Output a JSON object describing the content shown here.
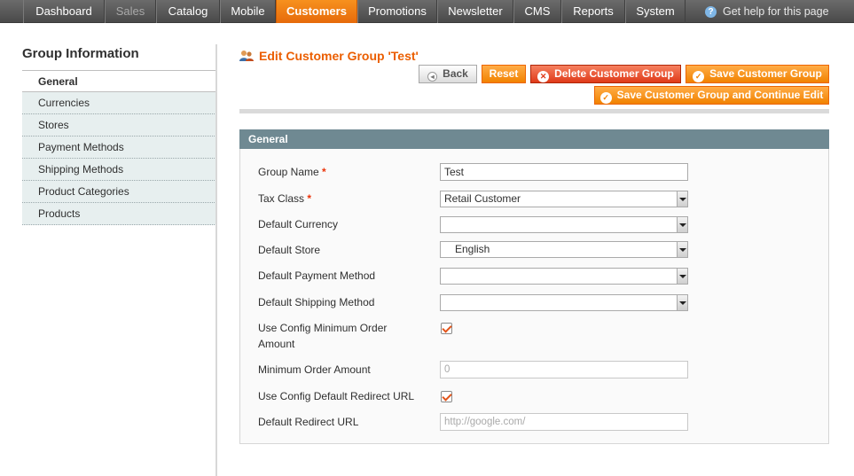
{
  "nav": {
    "items": [
      "Dashboard",
      "Sales",
      "Catalog",
      "Mobile",
      "Customers",
      "Promotions",
      "Newsletter",
      "CMS",
      "Reports",
      "System"
    ],
    "active": "Customers",
    "help": "Get help for this page"
  },
  "sidebar": {
    "title": "Group Information",
    "items": [
      "General",
      "Currencies",
      "Stores",
      "Payment Methods",
      "Shipping Methods",
      "Product Categories",
      "Products"
    ]
  },
  "header": {
    "title": "Edit Customer Group 'Test'",
    "buttons": {
      "back": "Back",
      "reset": "Reset",
      "delete": "Delete Customer Group",
      "save": "Save Customer Group",
      "save_continue": "Save Customer Group and Continue Edit"
    }
  },
  "section": {
    "title": "General",
    "fields": {
      "group_name": {
        "label": "Group Name",
        "required": "*",
        "value": "Test"
      },
      "tax_class": {
        "label": "Tax Class",
        "required": "*",
        "value": "Retail Customer"
      },
      "default_currency": {
        "label": "Default Currency",
        "value": ""
      },
      "default_store": {
        "label": "Default Store",
        "value": "English"
      },
      "default_payment": {
        "label": "Default Payment Method",
        "value": ""
      },
      "default_shipping": {
        "label": "Default Shipping Method",
        "value": ""
      },
      "use_config_min_line1": "Use Config Minimum Order",
      "use_config_min_line2": "Amount",
      "min_order": {
        "label": "Minimum Order Amount",
        "placeholder": "0"
      },
      "use_config_redirect": "Use Config Default Redirect URL",
      "redirect_url": {
        "label": "Default Redirect URL",
        "placeholder": "http://google.com/"
      }
    }
  },
  "colors": {
    "accent": "#eb5e00",
    "section_header": "#6f8992"
  }
}
